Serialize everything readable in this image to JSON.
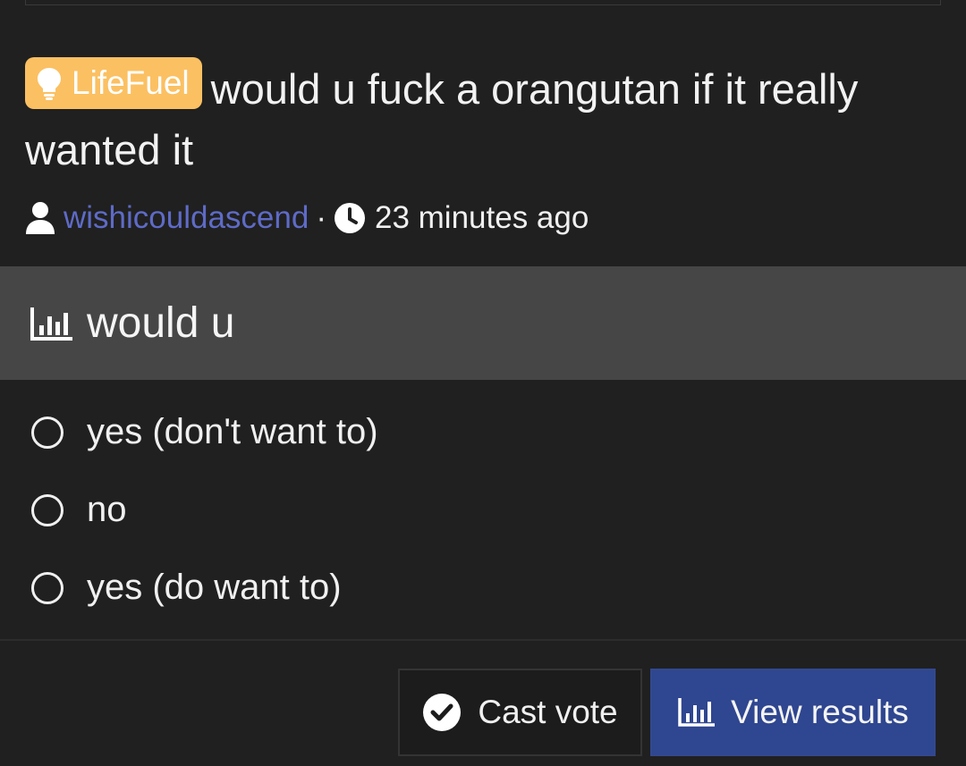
{
  "thread": {
    "tag_label": "LifeFuel",
    "tag_icon": "lightbulb-icon",
    "tag_color": "#fbc062",
    "title": "would u fuck a orangutan if it really wanted it",
    "author": "wishicouldascend",
    "separator": "·",
    "time": "23 minutes ago",
    "author_color": "#5e6bc7"
  },
  "poll": {
    "question": "would u",
    "options": [
      {
        "label": "yes (don't want to)"
      },
      {
        "label": "no"
      },
      {
        "label": "yes (do want to)"
      }
    ]
  },
  "actions": {
    "cast_vote_label": "Cast vote",
    "view_results_label": "View results",
    "view_results_color": "#2f4690"
  }
}
